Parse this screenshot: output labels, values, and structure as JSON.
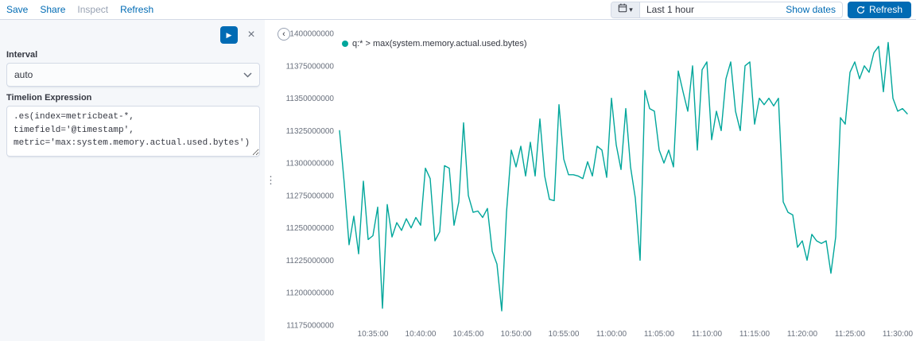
{
  "top_bar": {
    "save": "Save",
    "share": "Share",
    "inspect": "Inspect",
    "refresh": "Refresh",
    "time_range": "Last 1 hour",
    "show_dates": "Show dates",
    "refresh_button": "Refresh"
  },
  "panel": {
    "interval_label": "Interval",
    "interval_value": "auto",
    "expression_label": "Timelion Expression",
    "expression_value": ".es(index=metricbeat-*, timefield='@timestamp',\nmetric='max:system.memory.actual.used.bytes')"
  },
  "icons": {
    "play": "▶",
    "close": "×",
    "caret_down": "▾",
    "resize_handle": "⋮",
    "collapse_left": "‹"
  },
  "colors": {
    "accent_blue": "#006BB4",
    "series_teal": "#00A69B",
    "panel_bg": "#f5f7fa",
    "border": "#d3dae6"
  },
  "chart_data": {
    "type": "line",
    "title": "",
    "xlabel": "",
    "ylabel": "",
    "legend": "q:* > max(system.memory.actual.used.bytes)",
    "legend_position": "top-left",
    "grid": false,
    "color": "#00A69B",
    "ylim": [
      11175000000,
      11400000000
    ],
    "y_ticks": [
      11175000000,
      11200000000,
      11225000000,
      11250000000,
      11275000000,
      11300000000,
      11325000000,
      11350000000,
      11375000000,
      11400000000
    ],
    "x_domain_seconds": 3590,
    "x_interval_seconds": 30,
    "x_ticks": [
      {
        "t": 210,
        "label": "10:35:00"
      },
      {
        "t": 510,
        "label": "10:40:00"
      },
      {
        "t": 810,
        "label": "10:45:00"
      },
      {
        "t": 1110,
        "label": "10:50:00"
      },
      {
        "t": 1410,
        "label": "10:55:00"
      },
      {
        "t": 1710,
        "label": "11:00:00"
      },
      {
        "t": 2010,
        "label": "11:05:00"
      },
      {
        "t": 2310,
        "label": "11:10:00"
      },
      {
        "t": 2610,
        "label": "11:15:00"
      },
      {
        "t": 2910,
        "label": "11:20:00"
      },
      {
        "t": 3210,
        "label": "11:25:00"
      },
      {
        "t": 3510,
        "label": "11:30:00"
      }
    ],
    "values": [
      11325000000,
      11284000000,
      11237000000,
      11259000000,
      11230000000,
      11286000000,
      11241000000,
      11244000000,
      11266000000,
      11188000000,
      11268000000,
      11243000000,
      11254000000,
      11248000000,
      11257000000,
      11250000000,
      11258000000,
      11252000000,
      11296000000,
      11288000000,
      11240000000,
      11247000000,
      11298000000,
      11296000000,
      11252000000,
      11270000000,
      11331000000,
      11275000000,
      11262000000,
      11263000000,
      11258000000,
      11265000000,
      11232000000,
      11222000000,
      11186000000,
      11262000000,
      11310000000,
      11297000000,
      11313000000,
      11290000000,
      11316000000,
      11290000000,
      11334000000,
      11290000000,
      11272000000,
      11271000000,
      11345000000,
      11303000000,
      11291000000,
      11291000000,
      11290000000,
      11288000000,
      11301000000,
      11290000000,
      11313000000,
      11310000000,
      11289000000,
      11350000000,
      11314000000,
      11295000000,
      11342000000,
      11297000000,
      11273000000,
      11225000000,
      11356000000,
      11342000000,
      11340000000,
      11310000000,
      11300000000,
      11310000000,
      11297000000,
      11371000000,
      11355000000,
      11340000000,
      11375000000,
      11310000000,
      11372000000,
      11378000000,
      11318000000,
      11340000000,
      11325000000,
      11365000000,
      11378000000,
      11340000000,
      11325000000,
      11375000000,
      11378000000,
      11330000000,
      11350000000,
      11345000000,
      11350000000,
      11344000000,
      11350000000,
      11270000000,
      11262000000,
      11260000000,
      11235000000,
      11240000000,
      11225000000,
      11245000000,
      11240000000,
      11238000000,
      11240000000,
      11215000000,
      11243000000,
      11335000000,
      11330000000,
      11370000000,
      11378000000,
      11365000000,
      11375000000,
      11370000000,
      11385000000,
      11390000000,
      11355000000,
      11393000000,
      11350000000,
      11340000000,
      11342000000,
      11338000000
    ]
  }
}
